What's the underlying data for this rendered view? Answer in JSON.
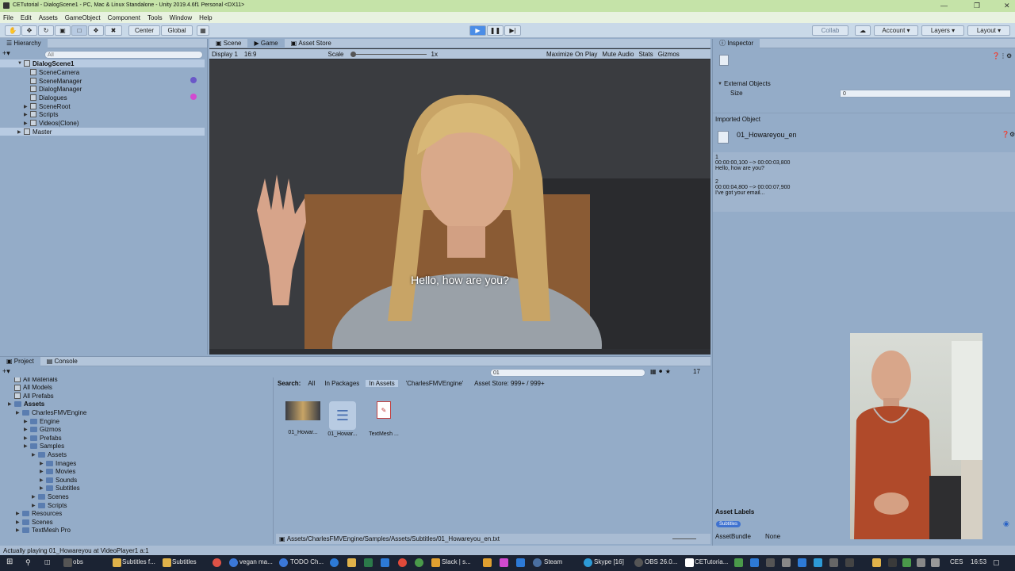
{
  "window": {
    "title": "CETutorial - DialogScene1 - PC, Mac & Linux Standalone - Unity 2019.4.6f1 Personal <DX11>"
  },
  "menu": [
    "File",
    "Edit",
    "Assets",
    "GameObject",
    "Component",
    "Tools",
    "Window",
    "Help"
  ],
  "toolbar": {
    "center": "Center",
    "global": "Global",
    "collab": "Collab",
    "account": "Account",
    "layers": "Layers",
    "layout": "Layout"
  },
  "hierarchy": {
    "tab": "Hierarchy",
    "search_placeholder": "All",
    "scene": "DialogScene1",
    "items": [
      "SceneCamera",
      "SceneManager",
      "DialogManager",
      "Dialogues",
      "SceneRoot",
      "Scripts",
      "Videos(Clone)"
    ],
    "master": "Master"
  },
  "game": {
    "tabs": [
      "Scene",
      "Game",
      "Asset Store"
    ],
    "display": "Display 1",
    "aspect": "16:9",
    "scale_label": "Scale",
    "scale_value": "1x",
    "maximize": "Maximize On Play",
    "mute": "Mute Audio",
    "stats": "Stats",
    "gizmos": "Gizmos",
    "subtitle": "Hello, how are you?"
  },
  "inspector": {
    "tab": "Inspector",
    "external_objects": "External Objects",
    "size_label": "Size",
    "size_value": "0",
    "imported_object": "Imported Object",
    "asset_name": "01_Howareyou_en",
    "srt": [
      {
        "index": "1",
        "time": "00:00:00,100 --> 00:00:03,800",
        "text": "Hello, how are you?"
      },
      {
        "index": "2",
        "time": "00:00:04,800 --> 00:00:07,900",
        "text": "I've got your email..."
      }
    ],
    "asset_labels": "Asset Labels",
    "label_chip": "Subtitles",
    "asset_bundle_label": "AssetBundle",
    "asset_bundle_value": "None"
  },
  "project": {
    "tabs": [
      "Project",
      "Console"
    ],
    "search_value": "01",
    "count": "17",
    "filters": {
      "search": "Search:",
      "all": "All",
      "in_packages": "In Packages",
      "in_assets": "In Assets",
      "folder": "'CharlesFMVEngine'",
      "asset_store": "Asset Store: 999+ / 999+"
    },
    "tree": [
      {
        "label": "All Materials",
        "indent": 0
      },
      {
        "label": "All Models",
        "indent": 0
      },
      {
        "label": "All Prefabs",
        "indent": 0
      },
      {
        "label": "Assets",
        "indent": 0
      },
      {
        "label": "CharlesFMVEngine",
        "indent": 1
      },
      {
        "label": "Engine",
        "indent": 2
      },
      {
        "label": "Gizmos",
        "indent": 2
      },
      {
        "label": "Prefabs",
        "indent": 2
      },
      {
        "label": "Samples",
        "indent": 2
      },
      {
        "label": "Assets",
        "indent": 3
      },
      {
        "label": "Images",
        "indent": 4
      },
      {
        "label": "Movies",
        "indent": 4
      },
      {
        "label": "Sounds",
        "indent": 4
      },
      {
        "label": "Subtitles",
        "indent": 4
      },
      {
        "label": "Scenes",
        "indent": 3
      },
      {
        "label": "Scripts",
        "indent": 3
      },
      {
        "label": "Resources",
        "indent": 1
      },
      {
        "label": "Scenes",
        "indent": 1
      },
      {
        "label": "TextMesh Pro",
        "indent": 1
      }
    ],
    "assets": [
      "01_Howar...",
      "01_Howar...",
      "TextMesh ..."
    ],
    "path": "Assets/CharlesFMVEngine/Samples/Assets/Subtitles/01_Howareyou_en.txt"
  },
  "status": "Actually playing 01_Howareyou at VideoPlayer1 a:1",
  "taskbar": {
    "items": [
      "obs",
      "Subtitles f...",
      "Subtitles",
      "vegan ma...",
      "TODO Ch...",
      "Slack | s...",
      "Steam",
      "Skype [16]",
      "OBS 26.0...",
      "CETutoria..."
    ],
    "lang": "CES",
    "time": "16:53"
  }
}
